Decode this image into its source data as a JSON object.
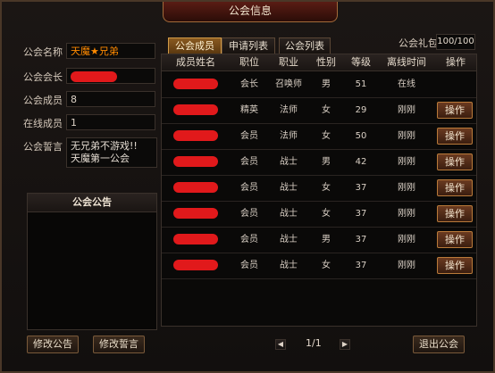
{
  "window": {
    "title": "公会信息"
  },
  "left": {
    "name_label": "公会名称",
    "name_value": "天魔★兄弟",
    "leader_label": "公会会长",
    "members_label": "公会成员",
    "members_value": "8",
    "online_label": "在线成员",
    "online_value": "1",
    "motto_label": "公会誓言",
    "motto_line1": "无兄弟不游戏!!",
    "motto_line2": "天魔第一公会",
    "announcement_title": "公会公告",
    "edit_announcement_btn": "修改公告",
    "edit_motto_btn": "修改誓言"
  },
  "tabs": [
    {
      "label": "公会成员",
      "active": true
    },
    {
      "label": "申请列表",
      "active": false
    },
    {
      "label": "公会列表",
      "active": false
    }
  ],
  "gift": {
    "label": "公会礼包",
    "value": "100/100"
  },
  "table": {
    "headers": [
      "成员姓名",
      "职位",
      "职业",
      "性别",
      "等级",
      "离线时间",
      "操作"
    ],
    "op_label": "操作",
    "rows": [
      {
        "position": "会长",
        "class": "召唤师",
        "gender": "男",
        "level": "51",
        "offline": "在线",
        "has_op": false
      },
      {
        "position": "精英",
        "class": "法师",
        "gender": "女",
        "level": "29",
        "offline": "刚刚",
        "has_op": true
      },
      {
        "position": "会员",
        "class": "法师",
        "gender": "女",
        "level": "50",
        "offline": "刚刚",
        "has_op": true
      },
      {
        "position": "会员",
        "class": "战士",
        "gender": "男",
        "level": "42",
        "offline": "刚刚",
        "has_op": true
      },
      {
        "position": "会员",
        "class": "战士",
        "gender": "女",
        "level": "37",
        "offline": "刚刚",
        "has_op": true
      },
      {
        "position": "会员",
        "class": "战士",
        "gender": "女",
        "level": "37",
        "offline": "刚刚",
        "has_op": true
      },
      {
        "position": "会员",
        "class": "战士",
        "gender": "男",
        "level": "37",
        "offline": "刚刚",
        "has_op": true
      },
      {
        "position": "会员",
        "class": "战士",
        "gender": "女",
        "level": "37",
        "offline": "刚刚",
        "has_op": true
      }
    ]
  },
  "pager": {
    "text": "1/1"
  },
  "exit_btn": "退出公会",
  "colors": {
    "accent": "#d19a47",
    "redaction": "#e1191b"
  }
}
